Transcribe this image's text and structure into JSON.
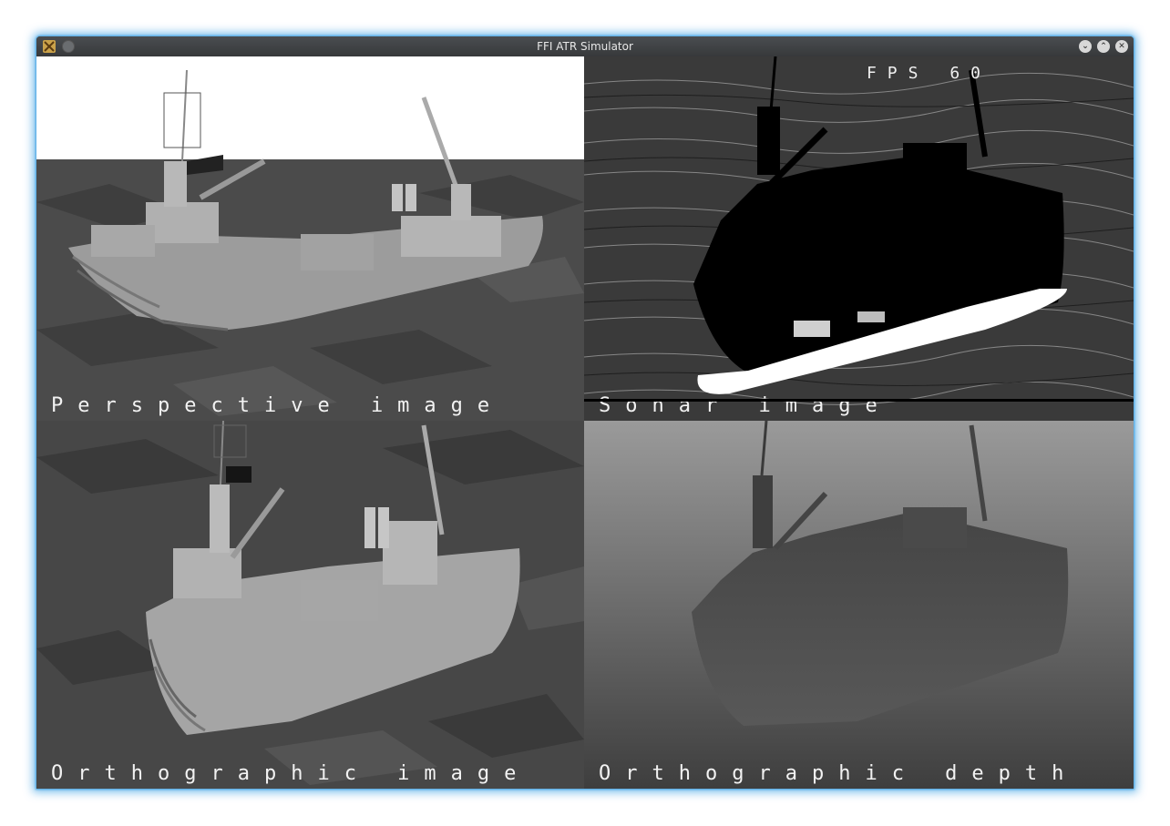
{
  "window": {
    "title": "FFI ATR Simulator",
    "icons": {
      "app": "app-icon",
      "menu": "menu-dot-icon",
      "minimize": "minimize-icon",
      "maximize": "maximize-icon",
      "close": "close-icon"
    }
  },
  "panels": {
    "perspective": {
      "label": "Perspective image"
    },
    "sonar": {
      "label": "Sonar image",
      "fps": "FPS 60"
    },
    "ortho_image": {
      "label": "Orthographic image"
    },
    "ortho_depth": {
      "label": "Orthographic depth"
    }
  },
  "colors": {
    "sky": "#ffffff",
    "sea": "#4a4a4a",
    "ship": "#a8a8a8",
    "sonar_bg": "#3a3a3a",
    "depth_bg": "#8a8a8a",
    "window_glow": "#3c9fe0"
  }
}
